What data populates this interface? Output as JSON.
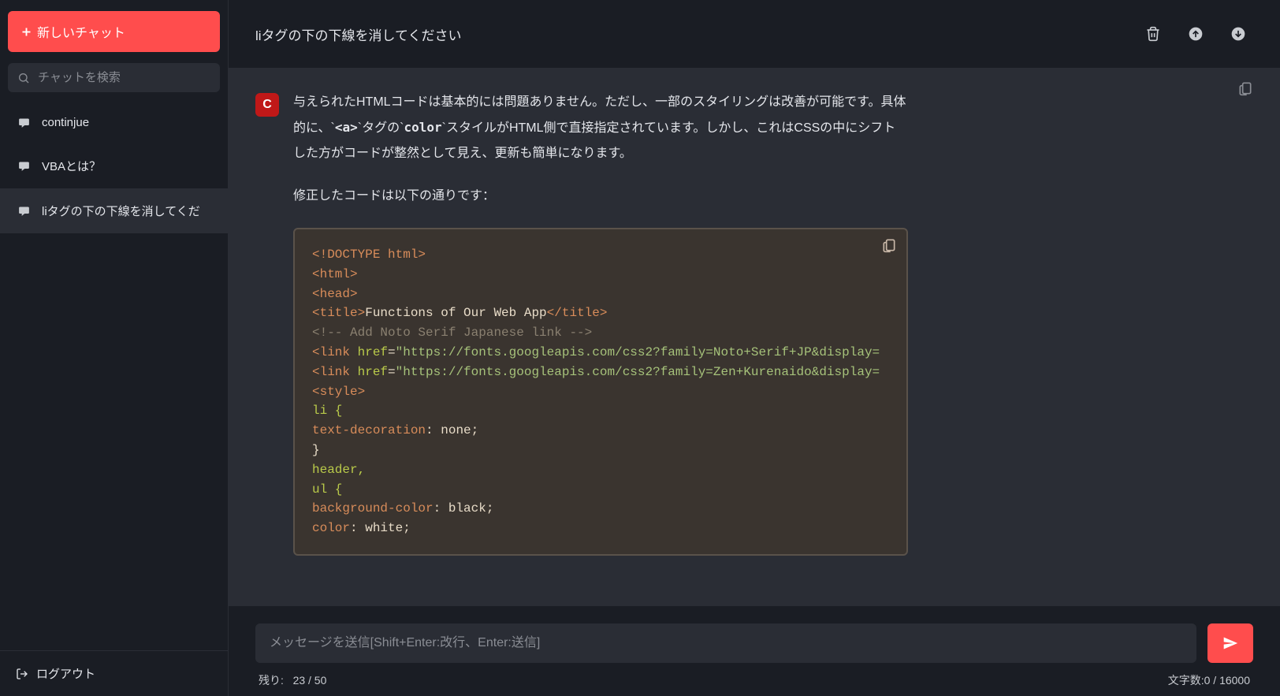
{
  "sidebar": {
    "new_chat_label": "新しいチャット",
    "search_placeholder": "チャットを検索",
    "items": [
      {
        "label": "continjue",
        "active": false
      },
      {
        "label": "VBAとは？",
        "active": false
      },
      {
        "label": "liタグの下の下線を消してくだ",
        "active": true
      }
    ],
    "logout_label": "ログアウト"
  },
  "header": {
    "title": "liタグの下の下線を消してください"
  },
  "message": {
    "avatar_letter": "C",
    "para1_a": "与えられたHTMLコードは基本的には問題ありません。ただし、一部のスタイリングは改善が可能です。具体的に、`",
    "para1_code1": "<a>",
    "para1_b": "`タグの`",
    "para1_code2": "color",
    "para1_c": "`スタイルがHTML側で直接指定されています。しかし、これはCSSの中にシフトした方がコードが整然として見え、更新も簡単になります。",
    "para2": "修正したコードは以下の通りです："
  },
  "code": {
    "l1_tag": "<!DOCTYPE html>",
    "l2_tag": "<html>",
    "l3_tag": "<head>",
    "l4_open": "<title>",
    "l4_text": "Functions of Our Web App",
    "l4_close": "</title>",
    "l5_comment": "<!-- Add Noto Serif Japanese link -->",
    "l6_open": "<link",
    "l6_attr": " href",
    "l6_eq": "=",
    "l6_str": "\"https://fonts.googleapis.com/css2?family=Noto+Serif+JP&display=",
    "l7_open": "<link",
    "l7_attr": " href",
    "l7_eq": "=",
    "l7_str": "\"https://fonts.googleapis.com/css2?family=Zen+Kurenaido&display=",
    "l8_tag": "<style>",
    "l9_sel": "li {",
    "l10_prop": "text-decoration",
    "l10_colon": ": ",
    "l10_val": "none;",
    "l11": "}",
    "l12_sel": "header,",
    "l13_sel": "ul {",
    "l14_prop": "background-color",
    "l14_colon": ": ",
    "l14_val": "black;",
    "l15_prop": "color",
    "l15_colon": ": ",
    "l15_val": "white;"
  },
  "input": {
    "placeholder": "メッセージを送信[Shift+Enter:改行、Enter:送信]"
  },
  "status": {
    "remaining_label": "残り:",
    "remaining_value": "23 / 50",
    "chars_label": "文字数:",
    "chars_value": "0 / 16000"
  }
}
